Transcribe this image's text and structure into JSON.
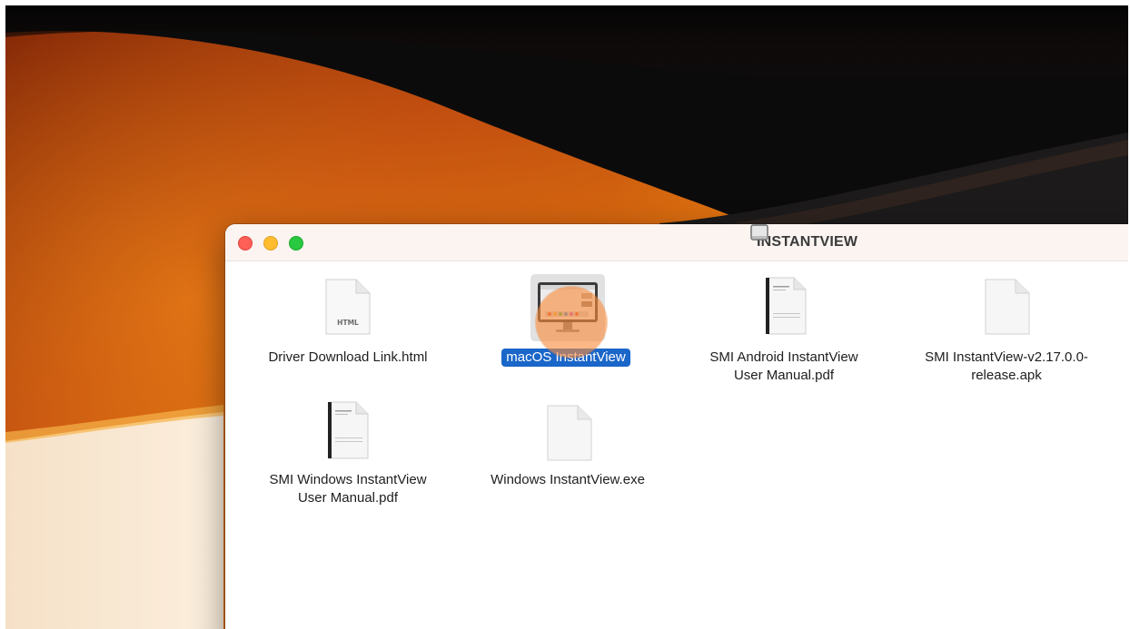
{
  "window": {
    "title": "INSTANTVIEW"
  },
  "files": [
    {
      "name": "Driver Download Link.html",
      "icon": "html-file-icon",
      "icon_text": "HTML",
      "selected": false
    },
    {
      "name": "macOS InstantView",
      "icon": "macos-app-icon",
      "selected": true
    },
    {
      "name": "SMI Android InstantView User Manual.pdf",
      "line1": "SMI Android InstantView",
      "line2": "User Manual.pdf",
      "icon": "pdf-file-icon",
      "selected": false
    },
    {
      "name": "SMI InstantView-v2.17.0.0-release.apk",
      "line1": "SMI InstantView-v2.17.0.0-",
      "line2": "release.apk",
      "icon": "apk-file-icon",
      "selected": false
    },
    {
      "name": "SMI Windows InstantView User Manual.pdf",
      "line1": "SMI Windows InstantView",
      "line2": "User Manual.pdf",
      "icon": "pdf-file-icon",
      "selected": false
    },
    {
      "name": "Windows InstantView.exe",
      "icon": "exe-file-icon",
      "selected": false
    }
  ],
  "colors": {
    "selection": "#1a66c9",
    "close": "#fe5f57",
    "minimize": "#febc2e",
    "zoom": "#28c840"
  }
}
